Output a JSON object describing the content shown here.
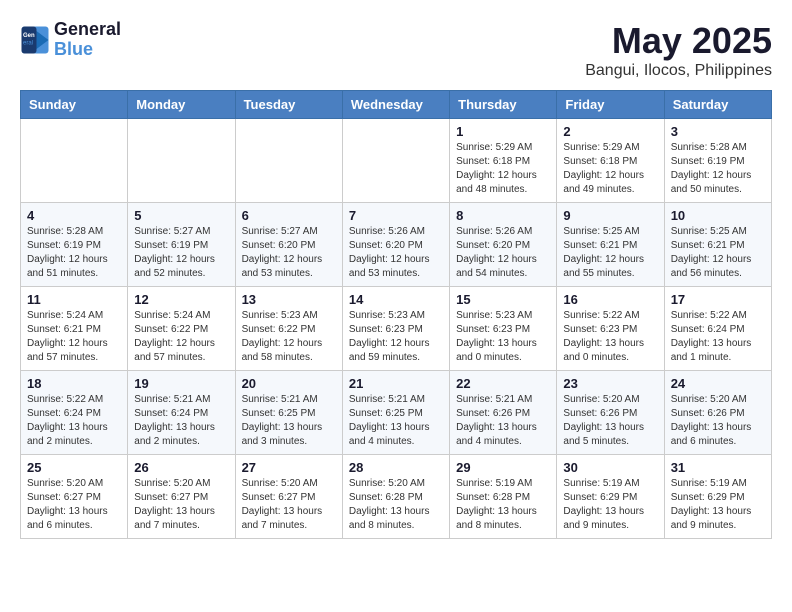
{
  "header": {
    "logo_line1": "General",
    "logo_line2": "Blue",
    "month": "May 2025",
    "location": "Bangui, Ilocos, Philippines"
  },
  "weekdays": [
    "Sunday",
    "Monday",
    "Tuesday",
    "Wednesday",
    "Thursday",
    "Friday",
    "Saturday"
  ],
  "weeks": [
    [
      {
        "day": "",
        "info": ""
      },
      {
        "day": "",
        "info": ""
      },
      {
        "day": "",
        "info": ""
      },
      {
        "day": "",
        "info": ""
      },
      {
        "day": "1",
        "info": "Sunrise: 5:29 AM\nSunset: 6:18 PM\nDaylight: 12 hours\nand 48 minutes."
      },
      {
        "day": "2",
        "info": "Sunrise: 5:29 AM\nSunset: 6:18 PM\nDaylight: 12 hours\nand 49 minutes."
      },
      {
        "day": "3",
        "info": "Sunrise: 5:28 AM\nSunset: 6:19 PM\nDaylight: 12 hours\nand 50 minutes."
      }
    ],
    [
      {
        "day": "4",
        "info": "Sunrise: 5:28 AM\nSunset: 6:19 PM\nDaylight: 12 hours\nand 51 minutes."
      },
      {
        "day": "5",
        "info": "Sunrise: 5:27 AM\nSunset: 6:19 PM\nDaylight: 12 hours\nand 52 minutes."
      },
      {
        "day": "6",
        "info": "Sunrise: 5:27 AM\nSunset: 6:20 PM\nDaylight: 12 hours\nand 53 minutes."
      },
      {
        "day": "7",
        "info": "Sunrise: 5:26 AM\nSunset: 6:20 PM\nDaylight: 12 hours\nand 53 minutes."
      },
      {
        "day": "8",
        "info": "Sunrise: 5:26 AM\nSunset: 6:20 PM\nDaylight: 12 hours\nand 54 minutes."
      },
      {
        "day": "9",
        "info": "Sunrise: 5:25 AM\nSunset: 6:21 PM\nDaylight: 12 hours\nand 55 minutes."
      },
      {
        "day": "10",
        "info": "Sunrise: 5:25 AM\nSunset: 6:21 PM\nDaylight: 12 hours\nand 56 minutes."
      }
    ],
    [
      {
        "day": "11",
        "info": "Sunrise: 5:24 AM\nSunset: 6:21 PM\nDaylight: 12 hours\nand 57 minutes."
      },
      {
        "day": "12",
        "info": "Sunrise: 5:24 AM\nSunset: 6:22 PM\nDaylight: 12 hours\nand 57 minutes."
      },
      {
        "day": "13",
        "info": "Sunrise: 5:23 AM\nSunset: 6:22 PM\nDaylight: 12 hours\nand 58 minutes."
      },
      {
        "day": "14",
        "info": "Sunrise: 5:23 AM\nSunset: 6:23 PM\nDaylight: 12 hours\nand 59 minutes."
      },
      {
        "day": "15",
        "info": "Sunrise: 5:23 AM\nSunset: 6:23 PM\nDaylight: 13 hours\nand 0 minutes."
      },
      {
        "day": "16",
        "info": "Sunrise: 5:22 AM\nSunset: 6:23 PM\nDaylight: 13 hours\nand 0 minutes."
      },
      {
        "day": "17",
        "info": "Sunrise: 5:22 AM\nSunset: 6:24 PM\nDaylight: 13 hours\nand 1 minute."
      }
    ],
    [
      {
        "day": "18",
        "info": "Sunrise: 5:22 AM\nSunset: 6:24 PM\nDaylight: 13 hours\nand 2 minutes."
      },
      {
        "day": "19",
        "info": "Sunrise: 5:21 AM\nSunset: 6:24 PM\nDaylight: 13 hours\nand 2 minutes."
      },
      {
        "day": "20",
        "info": "Sunrise: 5:21 AM\nSunset: 6:25 PM\nDaylight: 13 hours\nand 3 minutes."
      },
      {
        "day": "21",
        "info": "Sunrise: 5:21 AM\nSunset: 6:25 PM\nDaylight: 13 hours\nand 4 minutes."
      },
      {
        "day": "22",
        "info": "Sunrise: 5:21 AM\nSunset: 6:26 PM\nDaylight: 13 hours\nand 4 minutes."
      },
      {
        "day": "23",
        "info": "Sunrise: 5:20 AM\nSunset: 6:26 PM\nDaylight: 13 hours\nand 5 minutes."
      },
      {
        "day": "24",
        "info": "Sunrise: 5:20 AM\nSunset: 6:26 PM\nDaylight: 13 hours\nand 6 minutes."
      }
    ],
    [
      {
        "day": "25",
        "info": "Sunrise: 5:20 AM\nSunset: 6:27 PM\nDaylight: 13 hours\nand 6 minutes."
      },
      {
        "day": "26",
        "info": "Sunrise: 5:20 AM\nSunset: 6:27 PM\nDaylight: 13 hours\nand 7 minutes."
      },
      {
        "day": "27",
        "info": "Sunrise: 5:20 AM\nSunset: 6:27 PM\nDaylight: 13 hours\nand 7 minutes."
      },
      {
        "day": "28",
        "info": "Sunrise: 5:20 AM\nSunset: 6:28 PM\nDaylight: 13 hours\nand 8 minutes."
      },
      {
        "day": "29",
        "info": "Sunrise: 5:19 AM\nSunset: 6:28 PM\nDaylight: 13 hours\nand 8 minutes."
      },
      {
        "day": "30",
        "info": "Sunrise: 5:19 AM\nSunset: 6:29 PM\nDaylight: 13 hours\nand 9 minutes."
      },
      {
        "day": "31",
        "info": "Sunrise: 5:19 AM\nSunset: 6:29 PM\nDaylight: 13 hours\nand 9 minutes."
      }
    ]
  ]
}
